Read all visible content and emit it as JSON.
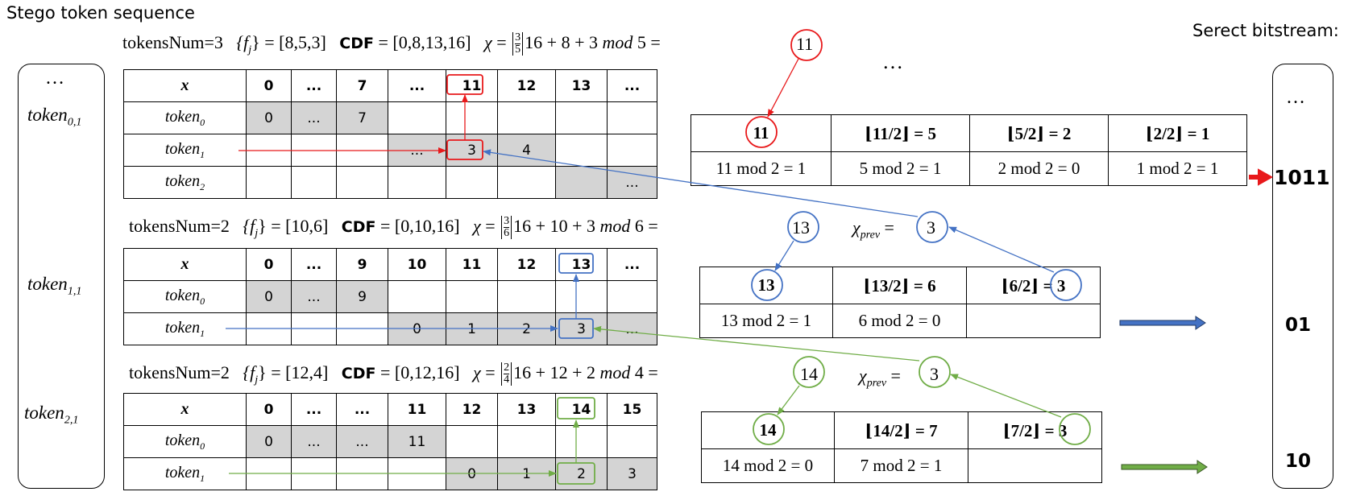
{
  "title": "Stego token sequence",
  "right_title": "Serect bitstream:",
  "ellipsis": "…",
  "left_tokens": [
    "…",
    "token",
    "0,1",
    "token",
    "1,1",
    "token",
    "2,1"
  ],
  "left_labels": {
    "dots": "…",
    "t0": "token",
    "t0sub": "0,1",
    "t1": "token",
    "t1sub": "1,1",
    "t2": "token",
    "t2sub": "2,1"
  },
  "right_bits": {
    "dots": "…",
    "b0": "1011",
    "b1": "01",
    "b2": "10"
  },
  "top_dots": "…",
  "sections": [
    {
      "tokensNum": "tokensNum=3",
      "fj": "= [8,5,3]",
      "cdf": "= [0,8,13,16]",
      "frac_num": "3",
      "frac_den": "5",
      "chi_tail": "16 + 8 + 3",
      "mod": "5",
      "result": "11",
      "table": {
        "header": [
          "x",
          "0",
          "...",
          "7",
          "...",
          "11",
          "12",
          "13",
          "..."
        ],
        "rows": [
          {
            "label": "token",
            "sub": "0",
            "cells": [
              "0",
              "...",
              "7",
              "",
              "",
              "",
              "",
              ""
            ]
          },
          {
            "label": "token",
            "sub": "1",
            "cells": [
              "",
              "",
              "",
              "...",
              "3",
              "4",
              "",
              ""
            ]
          },
          {
            "label": "token",
            "sub": "2",
            "cells": [
              "",
              "",
              "",
              "",
              "",
              "",
              "",
              "..."
            ]
          }
        ]
      },
      "bits_table": {
        "top": [
          "11",
          "⌊11/2⌋ = 5",
          "⌊5/2⌋ = 2",
          "⌊2/2⌋ = 1"
        ],
        "bottom": [
          "11 mod 2 = 1",
          "5 mod 2 = 1",
          "2 mod 2 = 0",
          "1 mod 2 = 1"
        ]
      }
    },
    {
      "tokensNum": "tokensNum=2",
      "fj": "= [10,6]",
      "cdf": "= [0,10,16]",
      "frac_num": "3",
      "frac_den": "6",
      "chi_tail": "16 + 10 + 3",
      "mod": "6",
      "result": "13",
      "chi_prev": "3",
      "table": {
        "header": [
          "x",
          "0",
          "...",
          "9",
          "10",
          "11",
          "12",
          "13",
          "..."
        ],
        "rows": [
          {
            "label": "token",
            "sub": "0",
            "cells": [
              "0",
              "...",
              "9",
              "",
              "",
              "",
              "",
              ""
            ]
          },
          {
            "label": "token",
            "sub": "1",
            "cells": [
              "",
              "",
              "",
              "0",
              "1",
              "2",
              "3",
              "..."
            ]
          }
        ]
      },
      "bits_table": {
        "top": [
          "13",
          "⌊13/2⌋ = 6",
          "⌊6/2⌋ = 3"
        ],
        "bottom": [
          "13 mod 2 = 1",
          "6 mod 2 = 0",
          ""
        ]
      }
    },
    {
      "tokensNum": "tokensNum=2",
      "fj": "= [12,4]",
      "cdf": "= [0,12,16]",
      "frac_num": "2",
      "frac_den": "4",
      "chi_tail": "16 + 12 + 2",
      "mod": "4",
      "result": "14",
      "chi_prev": "3",
      "table": {
        "header": [
          "x",
          "0",
          "...",
          "...",
          "11",
          "12",
          "13",
          "14",
          "15"
        ],
        "rows": [
          {
            "label": "token",
            "sub": "0",
            "cells": [
              "0",
              "...",
              "...",
              "11",
              "",
              "",
              "",
              ""
            ]
          },
          {
            "label": "token",
            "sub": "1",
            "cells": [
              "",
              "",
              "",
              "",
              "0",
              "1",
              "2",
              "3"
            ]
          }
        ]
      },
      "bits_table": {
        "top": [
          "14",
          "⌊14/2⌋ = 7",
          "⌊7/2⌋ = 3"
        ],
        "bottom": [
          "14 mod 2 = 0",
          "7 mod 2 = 1",
          ""
        ]
      }
    }
  ],
  "words": {
    "cdf": "CDF",
    "chi": "χ",
    "mod": "mod",
    "chi_prev_sym": "χ",
    "prev": "prev",
    "fj_open": "{f",
    "fj_sub": "j",
    "fj_close": "}"
  },
  "colors": {
    "red": "#e8191b",
    "blue": "#4472c4",
    "green": "#70ad47",
    "gray": "#d4d4d4"
  }
}
